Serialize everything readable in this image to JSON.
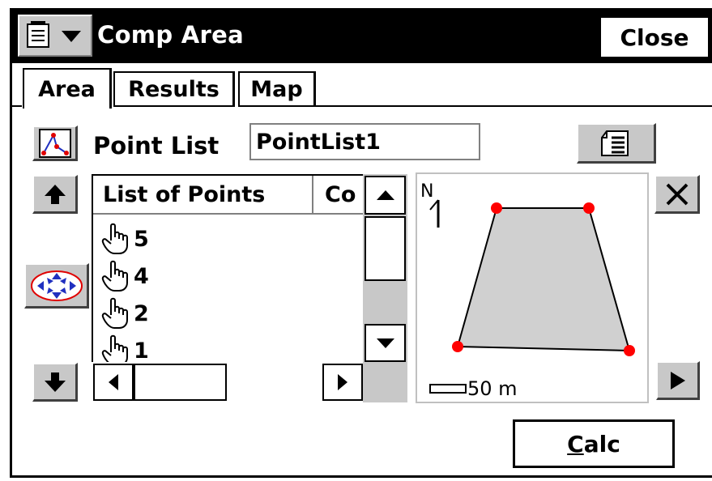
{
  "window": {
    "title": "Comp Area",
    "close_label": "Close"
  },
  "tabs": [
    {
      "label": "Area",
      "active": true
    },
    {
      "label": "Results",
      "active": false
    },
    {
      "label": "Map",
      "active": false
    }
  ],
  "point_list": {
    "label": "Point List",
    "value": "PointList1"
  },
  "list": {
    "columns": [
      "List of Points",
      "Co"
    ],
    "items": [
      "5",
      "4",
      "2",
      "1"
    ]
  },
  "map": {
    "north_label": "N",
    "scale_label": "50 m",
    "point_color": "#ff0000",
    "fill_color": "#d0d0d0"
  },
  "calc_label": "Calc",
  "calc_hotkey": "C",
  "calc_rest": "alc",
  "icons": {
    "menu": "app-menu-icon",
    "point_list": "polyline-icon",
    "notes": "notes-icon",
    "up": "arrow-up-icon",
    "down": "arrow-down-icon",
    "select_points": "select-points-icon",
    "delete": "close-icon",
    "next": "arrow-right-icon"
  }
}
